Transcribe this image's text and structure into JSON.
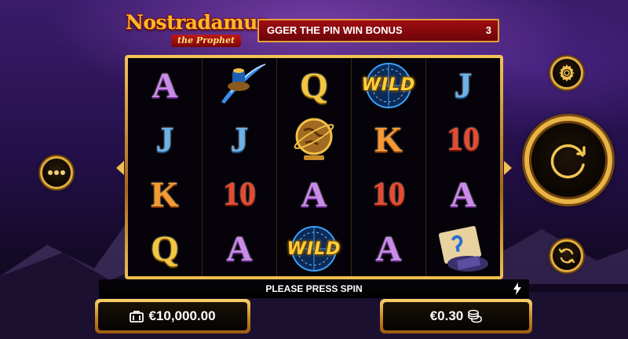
{
  "game": {
    "logo_title": "Nostradamus",
    "logo_subtitle": "the Prophet"
  },
  "ticker": {
    "text": "GGER THE PIN WIN BONUS",
    "count": "3"
  },
  "reels": [
    [
      "A",
      "J",
      "K",
      "Q"
    ],
    [
      "feather-ink-symbol",
      "J",
      "10",
      "A"
    ],
    [
      "Q",
      "globe-symbol",
      "A",
      "WILD"
    ],
    [
      "WILD",
      "K",
      "10",
      "A"
    ],
    [
      "J",
      "10",
      "A",
      "scroll-map-symbol"
    ]
  ],
  "wild_label": "WILD",
  "message": "PLEASE PRESS SPIN",
  "balance": {
    "amount": "€10,000.00",
    "icon": "wallet-icon"
  },
  "bet": {
    "amount": "€0.30",
    "icon": "coin-stack-icon"
  },
  "colors": {
    "gold": "#e3ad3d",
    "ticker_red": "#a00d12",
    "sky_purple": "#3a1c6a"
  }
}
